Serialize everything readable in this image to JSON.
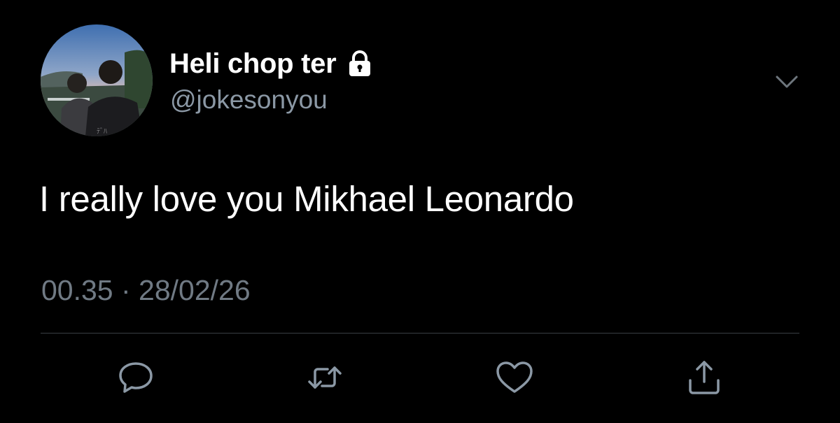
{
  "profile": {
    "display_name": "Heli chop ter",
    "handle": "@jokesonyou",
    "protected": true
  },
  "tweet": {
    "text": "I really love you Mikhael Leonardo",
    "timestamp": "00.35 · 28/02/26"
  },
  "actions": {
    "reply_icon": "reply-icon",
    "retweet_icon": "retweet-icon",
    "like_icon": "heart-icon",
    "share_icon": "share-icon"
  },
  "colors": {
    "background": "#000000",
    "text_primary": "#ffffff",
    "text_secondary": "#8b98a5",
    "icon_color": "#8b98a5",
    "divider": "#3a3f44"
  }
}
